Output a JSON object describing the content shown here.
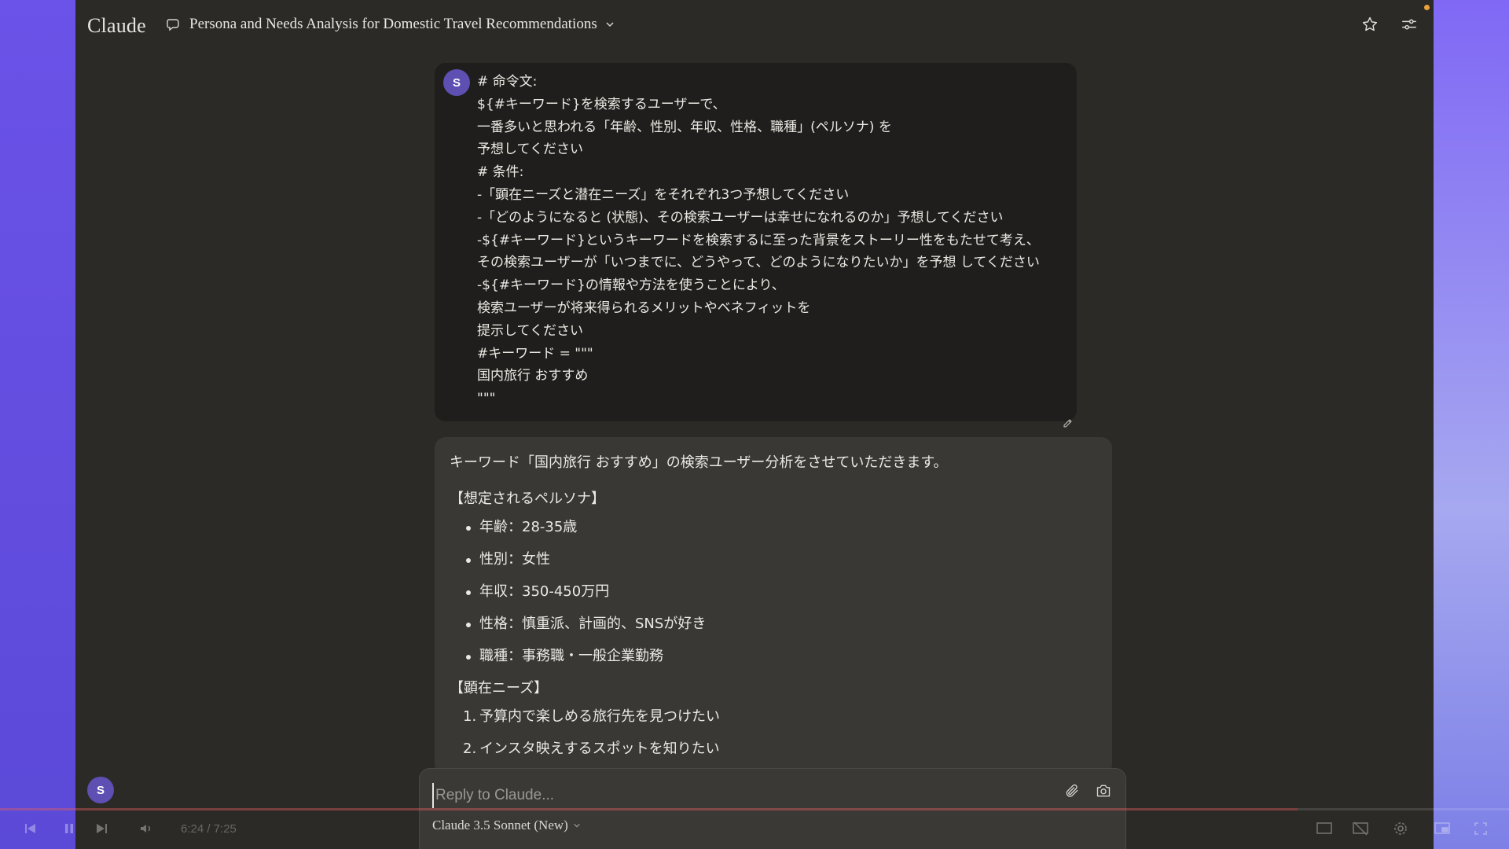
{
  "app": {
    "logo": "Claude"
  },
  "header": {
    "title": "Persona and Needs Analysis for Domestic Travel Recommendations"
  },
  "user": {
    "avatar_initial": "S"
  },
  "user_message": {
    "lines": [
      "# 命令文:",
      "${#キーワード}を検索するユーザーで、",
      "一番多いと思われる「年齢、性別、年収、性格、職種」(ペルソナ) を",
      "予想してください",
      "# 条件:",
      "-「顕在ニーズと潜在ニーズ」をそれぞれ3つ予想してください",
      "-「どのようになると (状態)、その検索ユーザーは幸せになれるのか」予想してください",
      "-${#キーワード}というキーワードを検索するに至った背景をストーリー性をもたせて考え、",
      "その検索ユーザーが「いつまでに、どうやって、どのようになりたいか」を予想 してください",
      "-${#キーワード}の情報や方法を使うことにより、",
      "検索ユーザーが将来得られるメリットやベネフィットを",
      "提示してください",
      "#キーワード = \"\"\"",
      "国内旅行 おすすめ",
      "\"\"\""
    ]
  },
  "assistant_message": {
    "intro": "キーワード「国内旅行 おすすめ」の検索ユーザー分析をさせていただきます。",
    "persona_heading": "【想定されるペルソナ】",
    "persona": [
      "年齢：28-35歳",
      "性別：女性",
      "年収：350-450万円",
      "性格：慎重派、計画的、SNSが好き",
      "職種：事務職・一般企業勤務"
    ],
    "needs_heading": "【顕在ニーズ】",
    "needs": [
      {
        "num": "1.",
        "text": "予算内で楽しめる旅行先を見つけたい"
      },
      {
        "num": "2.",
        "text": "インスタ映えするスポットを知りたい"
      }
    ]
  },
  "composer": {
    "placeholder": "Reply to Claude...",
    "model": "Claude 3.5 Sonnet (New)"
  },
  "player": {
    "time": "6:24 / 7:25",
    "progress": 0.86
  },
  "colors": {
    "app_bg": "#2b2a27",
    "user_bubble": "#1f1e1c",
    "assistant_bubble": "#393835",
    "avatar": "#5e4fb2",
    "backdrop": "#6a54e6",
    "notification": "#e9a23b"
  },
  "icons": [
    "chat-bubble-icon",
    "chevron-down-icon",
    "star-icon",
    "sliders-icon",
    "pencil-icon",
    "paperclip-icon",
    "camera-icon"
  ]
}
